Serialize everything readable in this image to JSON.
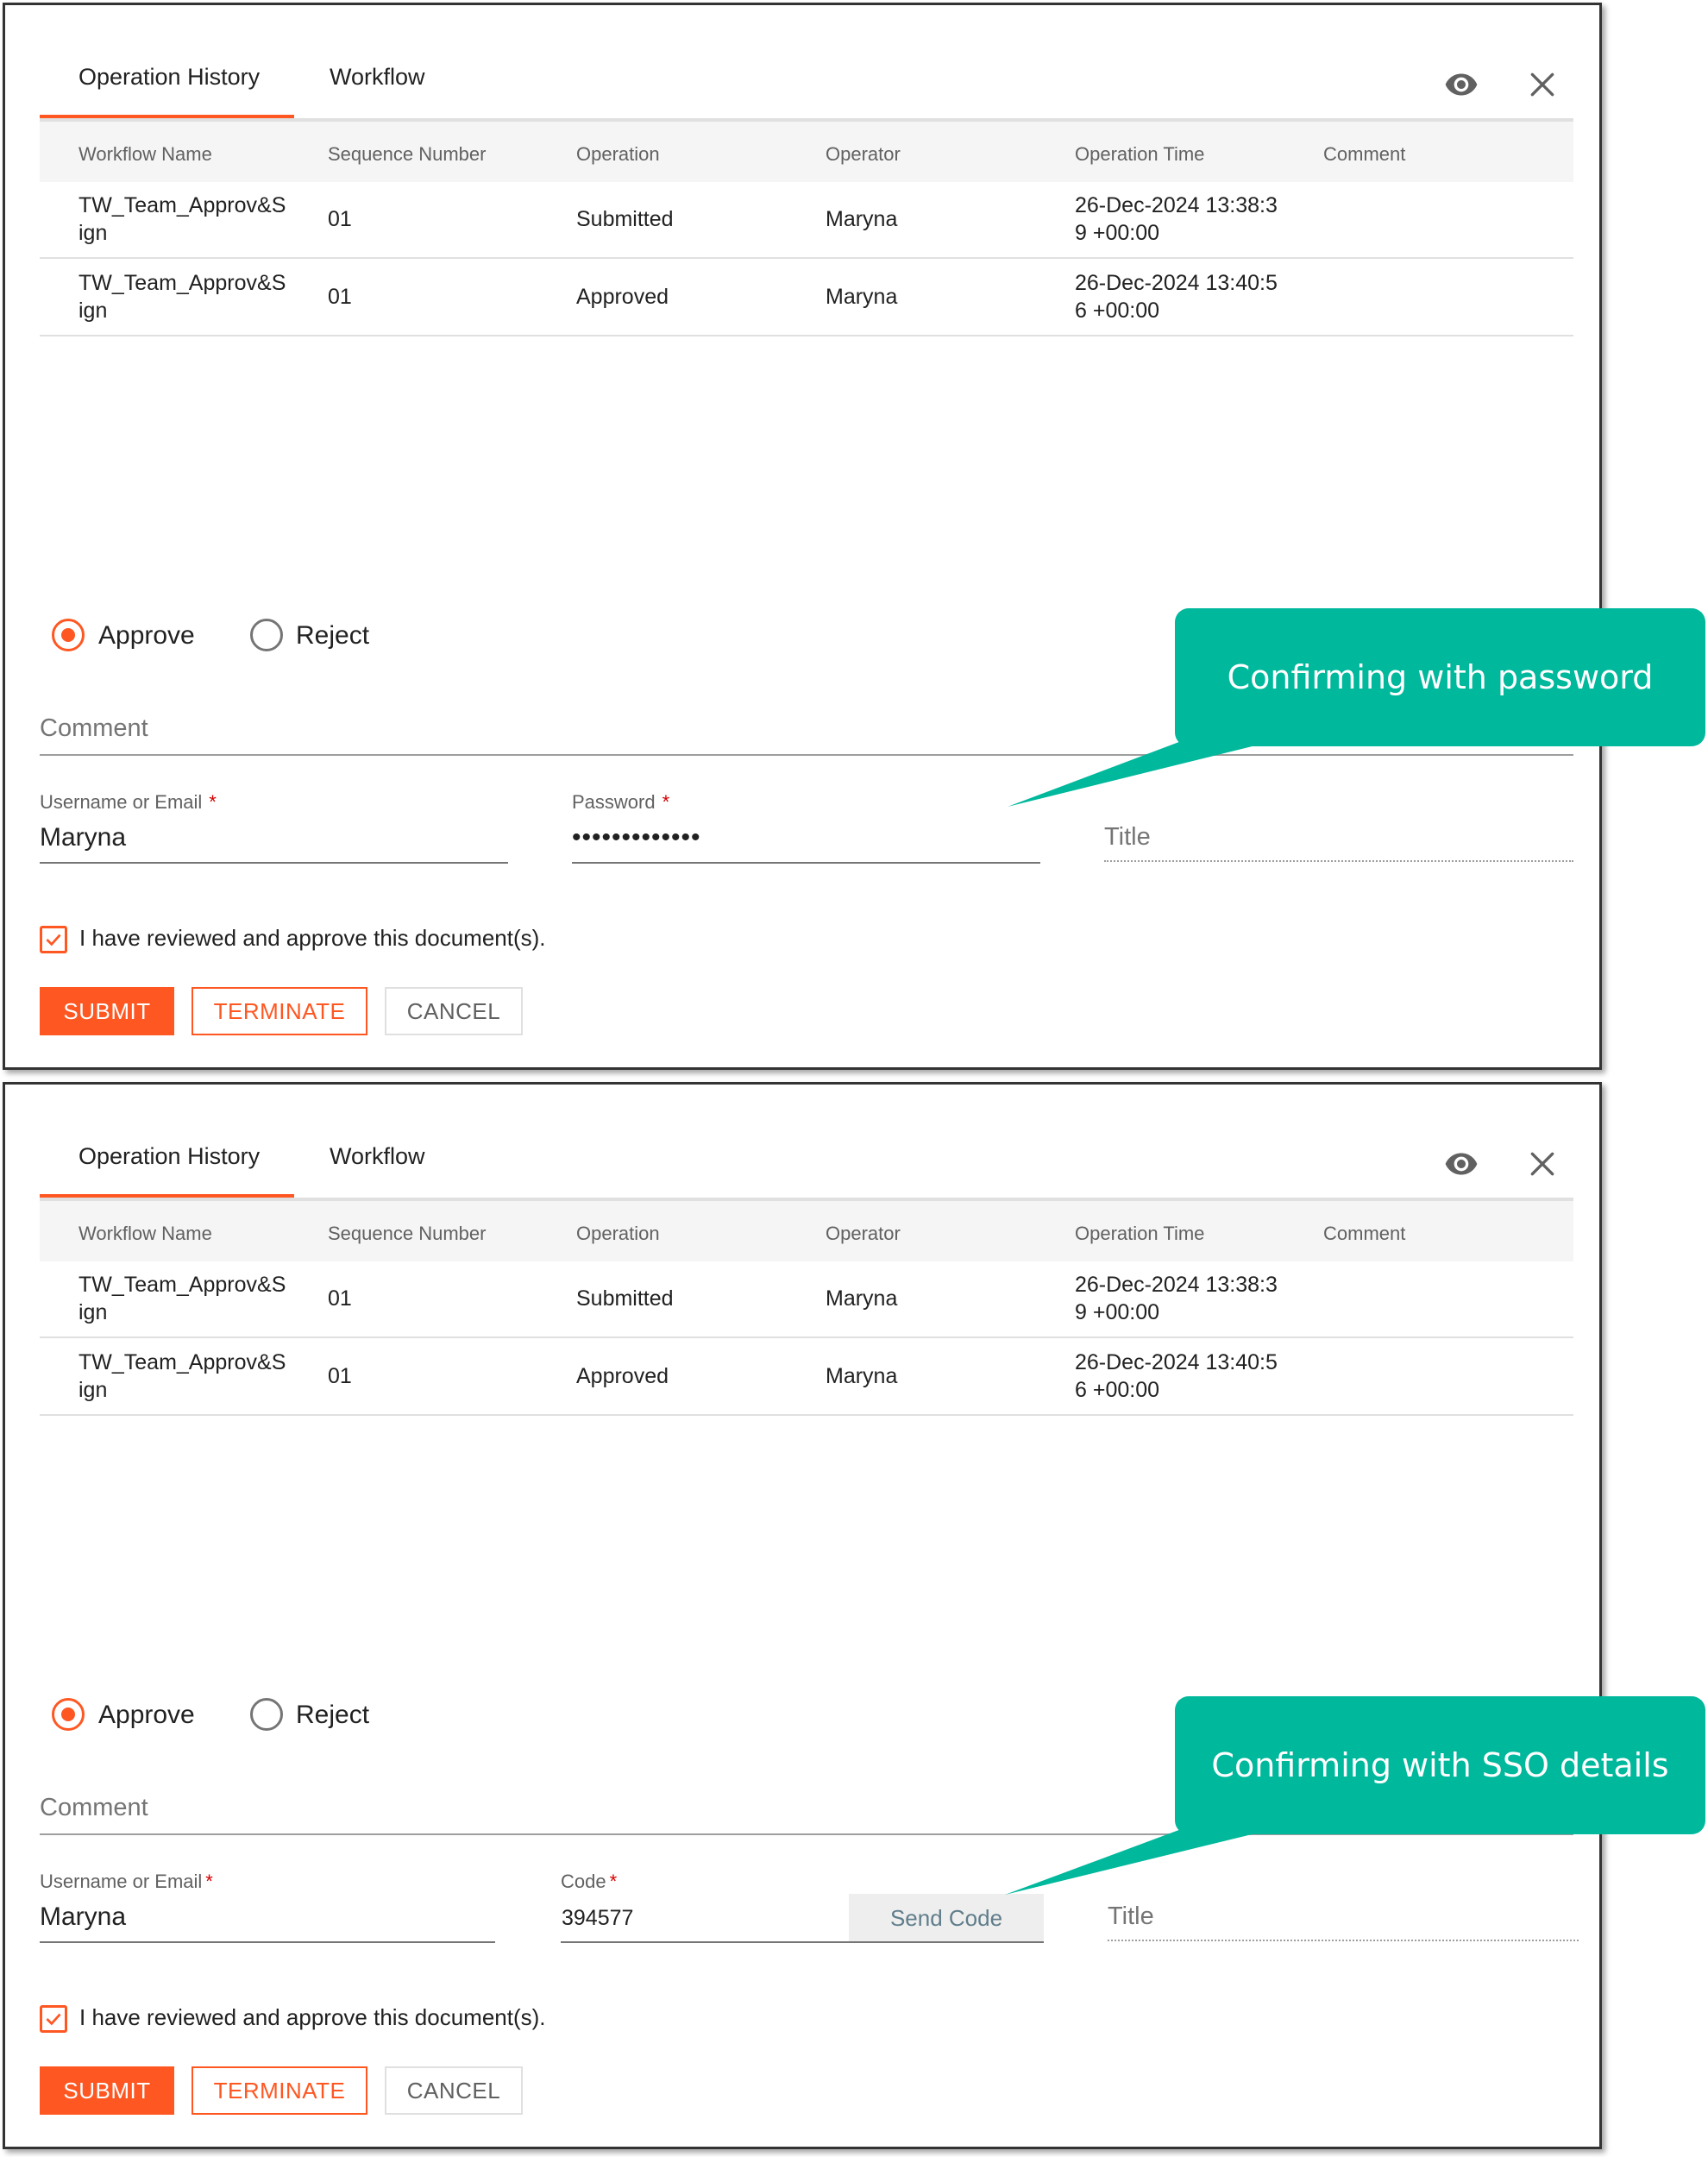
{
  "tabs": {
    "history": "Operation History",
    "workflow": "Workflow"
  },
  "icons": {
    "preview": "eye-icon",
    "close": "close-icon",
    "check": "checkmark-icon"
  },
  "table": {
    "headers": {
      "name": "Workflow Name",
      "seq": "Sequence Number",
      "op": "Operation",
      "operator": "Operator",
      "time": "Operation Time",
      "comment": "Comment"
    },
    "rows": [
      {
        "name_1": "TW_Team_Approv&S",
        "name_2": "ign",
        "seq": "01",
        "op": "Submitted",
        "operator": "Maryna",
        "time_1": "26-Dec-2024 13:38:3",
        "time_2": "9 +00:00"
      },
      {
        "name_1": "TW_Team_Approv&S",
        "name_2": "ign",
        "seq": "01",
        "op": "Approved",
        "operator": "Maryna",
        "time_1": "26-Dec-2024 13:40:5",
        "time_2": "6 +00:00"
      }
    ]
  },
  "form": {
    "approve": "Approve",
    "reject": "Reject",
    "comment_placeholder": "Comment",
    "username_label": "Username or Email",
    "required_mark": "*",
    "username_value": "Maryna",
    "password_label": "Password",
    "password_value": "•••••••••••••",
    "code_label": "Code",
    "code_value": "394577",
    "send_code": "Send Code",
    "title_placeholder": "Title",
    "confirm_text": "I have reviewed and approve this document(s).",
    "submit": "SUBMIT",
    "terminate": "TERMINATE",
    "cancel": "CANCEL"
  },
  "callouts": {
    "password": "Confirming with password",
    "sso": "Confirming with SSO details"
  },
  "colors": {
    "accent": "#ff5722",
    "callout": "#00b89c",
    "required": "#d50000"
  }
}
